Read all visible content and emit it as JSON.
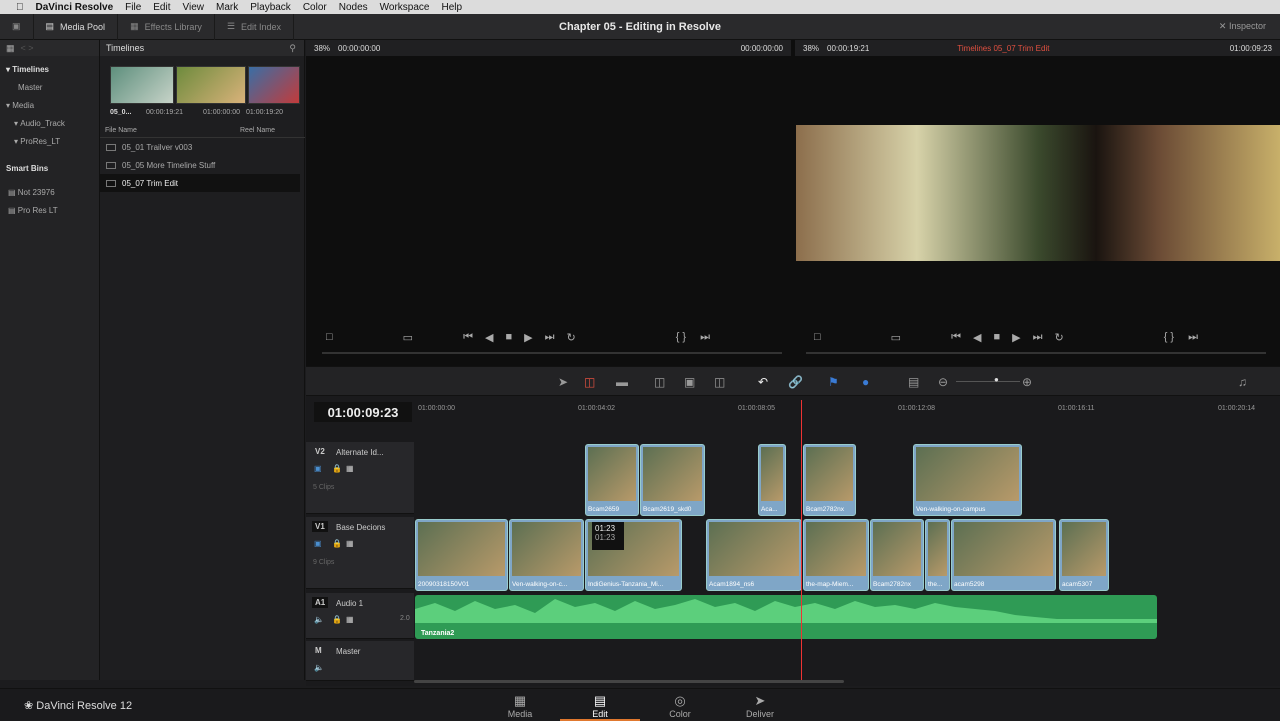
{
  "menubar": {
    "apple": "",
    "app": "DaVinci Resolve",
    "items": [
      "File",
      "Edit",
      "View",
      "Mark",
      "Playback",
      "Color",
      "Nodes",
      "Workspace",
      "Help"
    ]
  },
  "toolbar": {
    "media_pool": "Media Pool",
    "effects_library": "Effects Library",
    "edit_index": "Edit Index",
    "title": "Chapter 05 - Editing in Resolve",
    "inspector": "Inspector"
  },
  "left_panel": {
    "header": "Timelines",
    "tree": [
      "Timelines",
      "Master",
      "Media",
      "Audio_Track",
      "ProRes_LT"
    ],
    "smart_bins_title": "Smart Bins",
    "smart_bins": [
      "Not 23976",
      "Pro Res LT"
    ]
  },
  "media_pool": {
    "thumb_label": "05_0...",
    "thumb_timecodes": [
      "00:00:19:21",
      "01:00:00:00",
      "01:00:19:20"
    ],
    "col_file": "File Name",
    "col_reel": "Reel Name",
    "files": [
      "05_01 Trailver v003",
      "05_05 More Timeline Stuff",
      "05_07 Trim Edit"
    ]
  },
  "source_viewer": {
    "zoom": "38%",
    "timecode": "00:00:00:00",
    "right_tc": "00:00:00:00"
  },
  "timeline_viewer": {
    "zoom": "38%",
    "timecode": "00:00:19:21",
    "name": "Timelines 05_07 Trim Edit",
    "right_tc": "01:00:09:23"
  },
  "timeline": {
    "timecode": "01:00:09:23",
    "ruler": [
      "01:00:00:00",
      "01:00:04:02",
      "01:00:08:05",
      "01:00:12:08",
      "01:00:16:11",
      "01:00:20:14"
    ],
    "tracks": [
      {
        "tag": "V2",
        "name": "Alternate Id...",
        "count": "5 Clips"
      },
      {
        "tag": "V1",
        "name": "Base Decions",
        "count": "9 Clips"
      },
      {
        "tag": "A1",
        "name": "Audio 1",
        "level": "2.0"
      },
      {
        "tag": "M",
        "name": "Master"
      }
    ],
    "v2_clips": [
      "Bcam2659",
      "Bcam2619_skd0",
      "Aca...",
      "Bcam2782nx",
      "Ven-walking-on-campus"
    ],
    "v1_clips": [
      "20090318150V01",
      "Ven-walking-on-c...",
      "IndiGenius-Tanzania_Mi...",
      "Acam1894_ns6",
      "the-map-Miem...",
      "Bcam2782nx",
      "the...",
      "acam5298",
      "acam5307"
    ],
    "audio_clip": "Tanzania2",
    "trim_tooltip": [
      "01:23",
      "01:23"
    ]
  },
  "bottom": {
    "brand": "DaVinci Resolve 12",
    "pages": [
      "Media",
      "Edit",
      "Color",
      "Deliver"
    ],
    "active": "Edit"
  }
}
